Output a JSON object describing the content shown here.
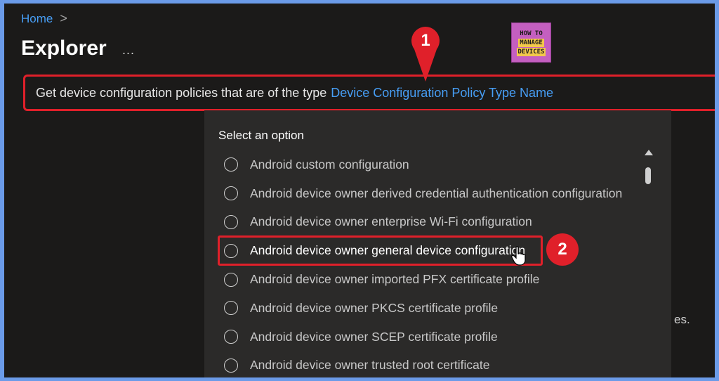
{
  "breadcrumb": {
    "home": "Home",
    "separator": ">"
  },
  "page": {
    "title": "Explorer",
    "more": "..."
  },
  "logo": {
    "line1": "HOW TO",
    "line2": "MANAGE",
    "line3": "DEVICES"
  },
  "query": {
    "prefix": "Get device configuration policies that are of the type",
    "link": "Device Configuration Policy Type Name"
  },
  "annotations": {
    "step1": "1",
    "step2": "2"
  },
  "dropdown": {
    "label": "Select an option",
    "options": [
      "Android custom configuration",
      "Android device owner derived credential authentication configuration",
      "Android device owner enterprise Wi-Fi configuration",
      "Android device owner general device configuration",
      "Android device owner imported PFX certificate profile",
      "Android device owner PKCS certificate profile",
      "Android device owner SCEP certificate profile",
      "Android device owner trusted root certificate"
    ],
    "highlighted_index": 3
  },
  "background_text": "es.",
  "colors": {
    "accent": "#479ef5",
    "annotation": "#e0202a",
    "background": "#1b1a19",
    "frame": "#6b9be8"
  }
}
